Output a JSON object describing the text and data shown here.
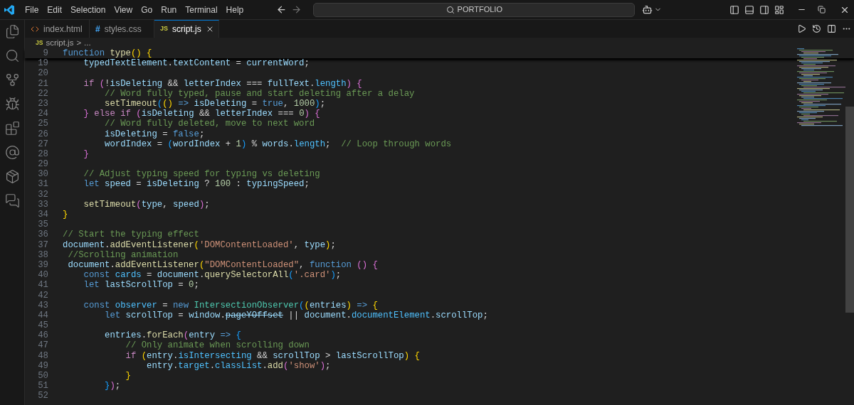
{
  "menu": [
    "File",
    "Edit",
    "Selection",
    "View",
    "Go",
    "Run",
    "Terminal",
    "Help"
  ],
  "search": {
    "value": "PORTFOLIO"
  },
  "tabs": [
    {
      "label": "index.html",
      "kind": "html",
      "selected": false
    },
    {
      "label": "styles.css",
      "kind": "css",
      "glyph": "#",
      "selected": false
    },
    {
      "label": "script.js",
      "kind": "js",
      "glyph": "JS",
      "selected": true
    }
  ],
  "breadcrumb": {
    "glyph": "JS",
    "file": "script.js",
    "separator": ">",
    "rest": "..."
  },
  "sticky_line": {
    "number": "9",
    "tokens": [
      {
        "kind": "st",
        "text": "function"
      },
      {
        "kind": "fn",
        "text": " type"
      },
      {
        "kind": "b1",
        "text": "()"
      },
      {
        "kind": "b1",
        "text": " {"
      }
    ]
  },
  "lines": [
    {
      "number": "19",
      "tokens": [
        {
          "kind": "var",
          "text": "    typedTextElement"
        },
        {
          "kind": "p",
          "text": "."
        },
        {
          "kind": "var",
          "text": "textContent"
        },
        {
          "kind": "p",
          "text": " = "
        },
        {
          "kind": "var",
          "text": "currentWord"
        },
        {
          "kind": "p",
          "text": ";"
        }
      ]
    },
    {
      "number": "20"
    },
    {
      "number": "21",
      "tokens": [
        {
          "kind": "kw",
          "text": "    if"
        },
        {
          "kind": "b2",
          "text": " ("
        },
        {
          "kind": "p",
          "text": "!"
        },
        {
          "kind": "var",
          "text": "isDeleting"
        },
        {
          "kind": "p",
          "text": " && "
        },
        {
          "kind": "var",
          "text": "letterIndex"
        },
        {
          "kind": "p",
          "text": " === "
        },
        {
          "kind": "var",
          "text": "fullText"
        },
        {
          "kind": "p",
          "text": "."
        },
        {
          "kind": "prop",
          "text": "length"
        },
        {
          "kind": "b2",
          "text": ")"
        },
        {
          "kind": "b2",
          "text": " {"
        }
      ]
    },
    {
      "number": "22",
      "tokens": [
        {
          "kind": "com",
          "text": "        // Word fully typed, pause and start deleting after a delay"
        }
      ]
    },
    {
      "number": "23",
      "tokens": [
        {
          "kind": "fn",
          "text": "        setTimeout"
        },
        {
          "kind": "b3",
          "text": "("
        },
        {
          "kind": "b1",
          "text": "()"
        },
        {
          "kind": "st",
          "text": " =>"
        },
        {
          "kind": "var",
          "text": " isDeleting"
        },
        {
          "kind": "p",
          "text": " = "
        },
        {
          "kind": "st",
          "text": "true"
        },
        {
          "kind": "p",
          "text": ", "
        },
        {
          "kind": "num",
          "text": "1000"
        },
        {
          "kind": "b3",
          "text": ")"
        },
        {
          "kind": "p",
          "text": ";"
        }
      ]
    },
    {
      "number": "24",
      "tokens": [
        {
          "kind": "b2",
          "text": "    }"
        },
        {
          "kind": "kw",
          "text": " else if"
        },
        {
          "kind": "b2",
          "text": " ("
        },
        {
          "kind": "var",
          "text": "isDeleting"
        },
        {
          "kind": "p",
          "text": " && "
        },
        {
          "kind": "var",
          "text": "letterIndex"
        },
        {
          "kind": "p",
          "text": " === "
        },
        {
          "kind": "num",
          "text": "0"
        },
        {
          "kind": "b2",
          "text": ")"
        },
        {
          "kind": "b2",
          "text": " {"
        }
      ]
    },
    {
      "number": "25",
      "tokens": [
        {
          "kind": "com",
          "text": "        // Word fully deleted, move to next word"
        }
      ]
    },
    {
      "number": "26",
      "tokens": [
        {
          "kind": "var",
          "text": "        isDeleting"
        },
        {
          "kind": "p",
          "text": " = "
        },
        {
          "kind": "st",
          "text": "false"
        },
        {
          "kind": "p",
          "text": ";"
        }
      ]
    },
    {
      "number": "27",
      "tokens": [
        {
          "kind": "var",
          "text": "        wordIndex"
        },
        {
          "kind": "p",
          "text": " = "
        },
        {
          "kind": "b3",
          "text": "("
        },
        {
          "kind": "var",
          "text": "wordIndex"
        },
        {
          "kind": "p",
          "text": " + "
        },
        {
          "kind": "num",
          "text": "1"
        },
        {
          "kind": "b3",
          "text": ")"
        },
        {
          "kind": "p",
          "text": " % "
        },
        {
          "kind": "var",
          "text": "words"
        },
        {
          "kind": "p",
          "text": "."
        },
        {
          "kind": "prop",
          "text": "length"
        },
        {
          "kind": "p",
          "text": ";"
        },
        {
          "kind": "com",
          "text": "  // Loop through words"
        }
      ]
    },
    {
      "number": "28",
      "tokens": [
        {
          "kind": "b2",
          "text": "    }"
        }
      ]
    },
    {
      "number": "29"
    },
    {
      "number": "30",
      "tokens": [
        {
          "kind": "com",
          "text": "    // Adjust typing speed for typing vs deleting"
        }
      ]
    },
    {
      "number": "31",
      "tokens": [
        {
          "kind": "st",
          "text": "    let"
        },
        {
          "kind": "var",
          "text": " speed"
        },
        {
          "kind": "p",
          "text": " = "
        },
        {
          "kind": "var",
          "text": "isDeleting"
        },
        {
          "kind": "p",
          "text": " ? "
        },
        {
          "kind": "num",
          "text": "100"
        },
        {
          "kind": "p",
          "text": " : "
        },
        {
          "kind": "var",
          "text": "typingSpeed"
        },
        {
          "kind": "p",
          "text": ";"
        }
      ]
    },
    {
      "number": "32"
    },
    {
      "number": "33",
      "tokens": [
        {
          "kind": "fn",
          "text": "    setTimeout"
        },
        {
          "kind": "b2",
          "text": "("
        },
        {
          "kind": "var",
          "text": "type"
        },
        {
          "kind": "p",
          "text": ", "
        },
        {
          "kind": "var",
          "text": "speed"
        },
        {
          "kind": "b2",
          "text": ")"
        },
        {
          "kind": "p",
          "text": ";"
        }
      ]
    },
    {
      "number": "34",
      "tokens": [
        {
          "kind": "b1",
          "text": "}"
        }
      ]
    },
    {
      "number": "35"
    },
    {
      "number": "36",
      "tokens": [
        {
          "kind": "com",
          "text": "// Start the typing effect"
        }
      ]
    },
    {
      "number": "37",
      "tokens": [
        {
          "kind": "var",
          "text": "document"
        },
        {
          "kind": "p",
          "text": "."
        },
        {
          "kind": "fn",
          "text": "addEventListener"
        },
        {
          "kind": "b1",
          "text": "("
        },
        {
          "kind": "str",
          "text": "'DOMContentLoaded'"
        },
        {
          "kind": "p",
          "text": ", "
        },
        {
          "kind": "var",
          "text": "type"
        },
        {
          "kind": "b1",
          "text": ")"
        },
        {
          "kind": "p",
          "text": ";"
        }
      ]
    },
    {
      "number": "38",
      "tokens": [
        {
          "kind": "com",
          "text": " //Scrolling animation"
        }
      ]
    },
    {
      "number": "39",
      "tokens": [
        {
          "kind": "var",
          "text": " document"
        },
        {
          "kind": "p",
          "text": "."
        },
        {
          "kind": "fn",
          "text": "addEventListener"
        },
        {
          "kind": "b1",
          "text": "("
        },
        {
          "kind": "str",
          "text": "\"DOMContentLoaded\""
        },
        {
          "kind": "p",
          "text": ", "
        },
        {
          "kind": "st",
          "text": "function"
        },
        {
          "kind": "b2",
          "text": " ()"
        },
        {
          "kind": "b2",
          "text": " {"
        }
      ]
    },
    {
      "number": "40",
      "tokens": [
        {
          "kind": "st",
          "text": "    const"
        },
        {
          "kind": "prop",
          "text": " cards"
        },
        {
          "kind": "p",
          "text": " = "
        },
        {
          "kind": "var",
          "text": "document"
        },
        {
          "kind": "p",
          "text": "."
        },
        {
          "kind": "fn",
          "text": "querySelectorAll"
        },
        {
          "kind": "b3",
          "text": "("
        },
        {
          "kind": "str",
          "text": "'.card'"
        },
        {
          "kind": "b3",
          "text": ")"
        },
        {
          "kind": "p",
          "text": ";"
        }
      ]
    },
    {
      "number": "41",
      "tokens": [
        {
          "kind": "st",
          "text": "    let"
        },
        {
          "kind": "var",
          "text": " lastScrollTop"
        },
        {
          "kind": "p",
          "text": " = "
        },
        {
          "kind": "num",
          "text": "0"
        },
        {
          "kind": "p",
          "text": ";"
        }
      ]
    },
    {
      "number": "42"
    },
    {
      "number": "43",
      "tokens": [
        {
          "kind": "st",
          "text": "    const"
        },
        {
          "kind": "prop",
          "text": " observer"
        },
        {
          "kind": "p",
          "text": " = "
        },
        {
          "kind": "st",
          "text": "new"
        },
        {
          "kind": "cls",
          "text": " IntersectionObserver"
        },
        {
          "kind": "b3",
          "text": "("
        },
        {
          "kind": "b1",
          "text": "("
        },
        {
          "kind": "var",
          "text": "entries"
        },
        {
          "kind": "b1",
          "text": ")"
        },
        {
          "kind": "st",
          "text": " =>"
        },
        {
          "kind": "b1",
          "text": " {"
        }
      ]
    },
    {
      "number": "44",
      "tokens": [
        {
          "kind": "st",
          "text": "        let"
        },
        {
          "kind": "var",
          "text": " scrollTop"
        },
        {
          "kind": "p",
          "text": " = "
        },
        {
          "kind": "var",
          "text": "window"
        },
        {
          "kind": "p",
          "text": "."
        },
        {
          "kind": "dep",
          "text": "pageYOffset"
        },
        {
          "kind": "p",
          "text": " || "
        },
        {
          "kind": "var",
          "text": "document"
        },
        {
          "kind": "p",
          "text": "."
        },
        {
          "kind": "prop",
          "text": "documentElement"
        },
        {
          "kind": "p",
          "text": "."
        },
        {
          "kind": "var",
          "text": "scrollTop"
        },
        {
          "kind": "p",
          "text": ";"
        }
      ]
    },
    {
      "number": "45"
    },
    {
      "number": "46",
      "tokens": [
        {
          "kind": "var",
          "text": "        entries"
        },
        {
          "kind": "p",
          "text": "."
        },
        {
          "kind": "fn",
          "text": "forEach"
        },
        {
          "kind": "b2",
          "text": "("
        },
        {
          "kind": "var",
          "text": "entry"
        },
        {
          "kind": "st",
          "text": " =>"
        },
        {
          "kind": "b3",
          "text": " {"
        }
      ]
    },
    {
      "number": "47",
      "tokens": [
        {
          "kind": "com",
          "text": "            // Only animate when scrolling down"
        }
      ]
    },
    {
      "number": "48",
      "tokens": [
        {
          "kind": "kw",
          "text": "            if"
        },
        {
          "kind": "b1",
          "text": " ("
        },
        {
          "kind": "var",
          "text": "entry"
        },
        {
          "kind": "p",
          "text": "."
        },
        {
          "kind": "prop",
          "text": "isIntersecting"
        },
        {
          "kind": "p",
          "text": " && "
        },
        {
          "kind": "var",
          "text": "scrollTop"
        },
        {
          "kind": "p",
          "text": " > "
        },
        {
          "kind": "var",
          "text": "lastScrollTop"
        },
        {
          "kind": "b1",
          "text": ")"
        },
        {
          "kind": "b1",
          "text": " {"
        }
      ]
    },
    {
      "number": "49",
      "tokens": [
        {
          "kind": "var",
          "text": "                entry"
        },
        {
          "kind": "p",
          "text": "."
        },
        {
          "kind": "prop",
          "text": "target"
        },
        {
          "kind": "p",
          "text": "."
        },
        {
          "kind": "prop",
          "text": "classList"
        },
        {
          "kind": "p",
          "text": "."
        },
        {
          "kind": "fn",
          "text": "add"
        },
        {
          "kind": "b2",
          "text": "("
        },
        {
          "kind": "str",
          "text": "'show'"
        },
        {
          "kind": "b2",
          "text": ")"
        },
        {
          "kind": "p",
          "text": ";"
        }
      ]
    },
    {
      "number": "50",
      "tokens": [
        {
          "kind": "b1",
          "text": "            }"
        }
      ]
    },
    {
      "number": "51",
      "tokens": [
        {
          "kind": "b3",
          "text": "        }"
        },
        {
          "kind": "b2",
          "text": ")"
        },
        {
          "kind": "p",
          "text": ";"
        }
      ]
    },
    {
      "number": "52"
    }
  ]
}
